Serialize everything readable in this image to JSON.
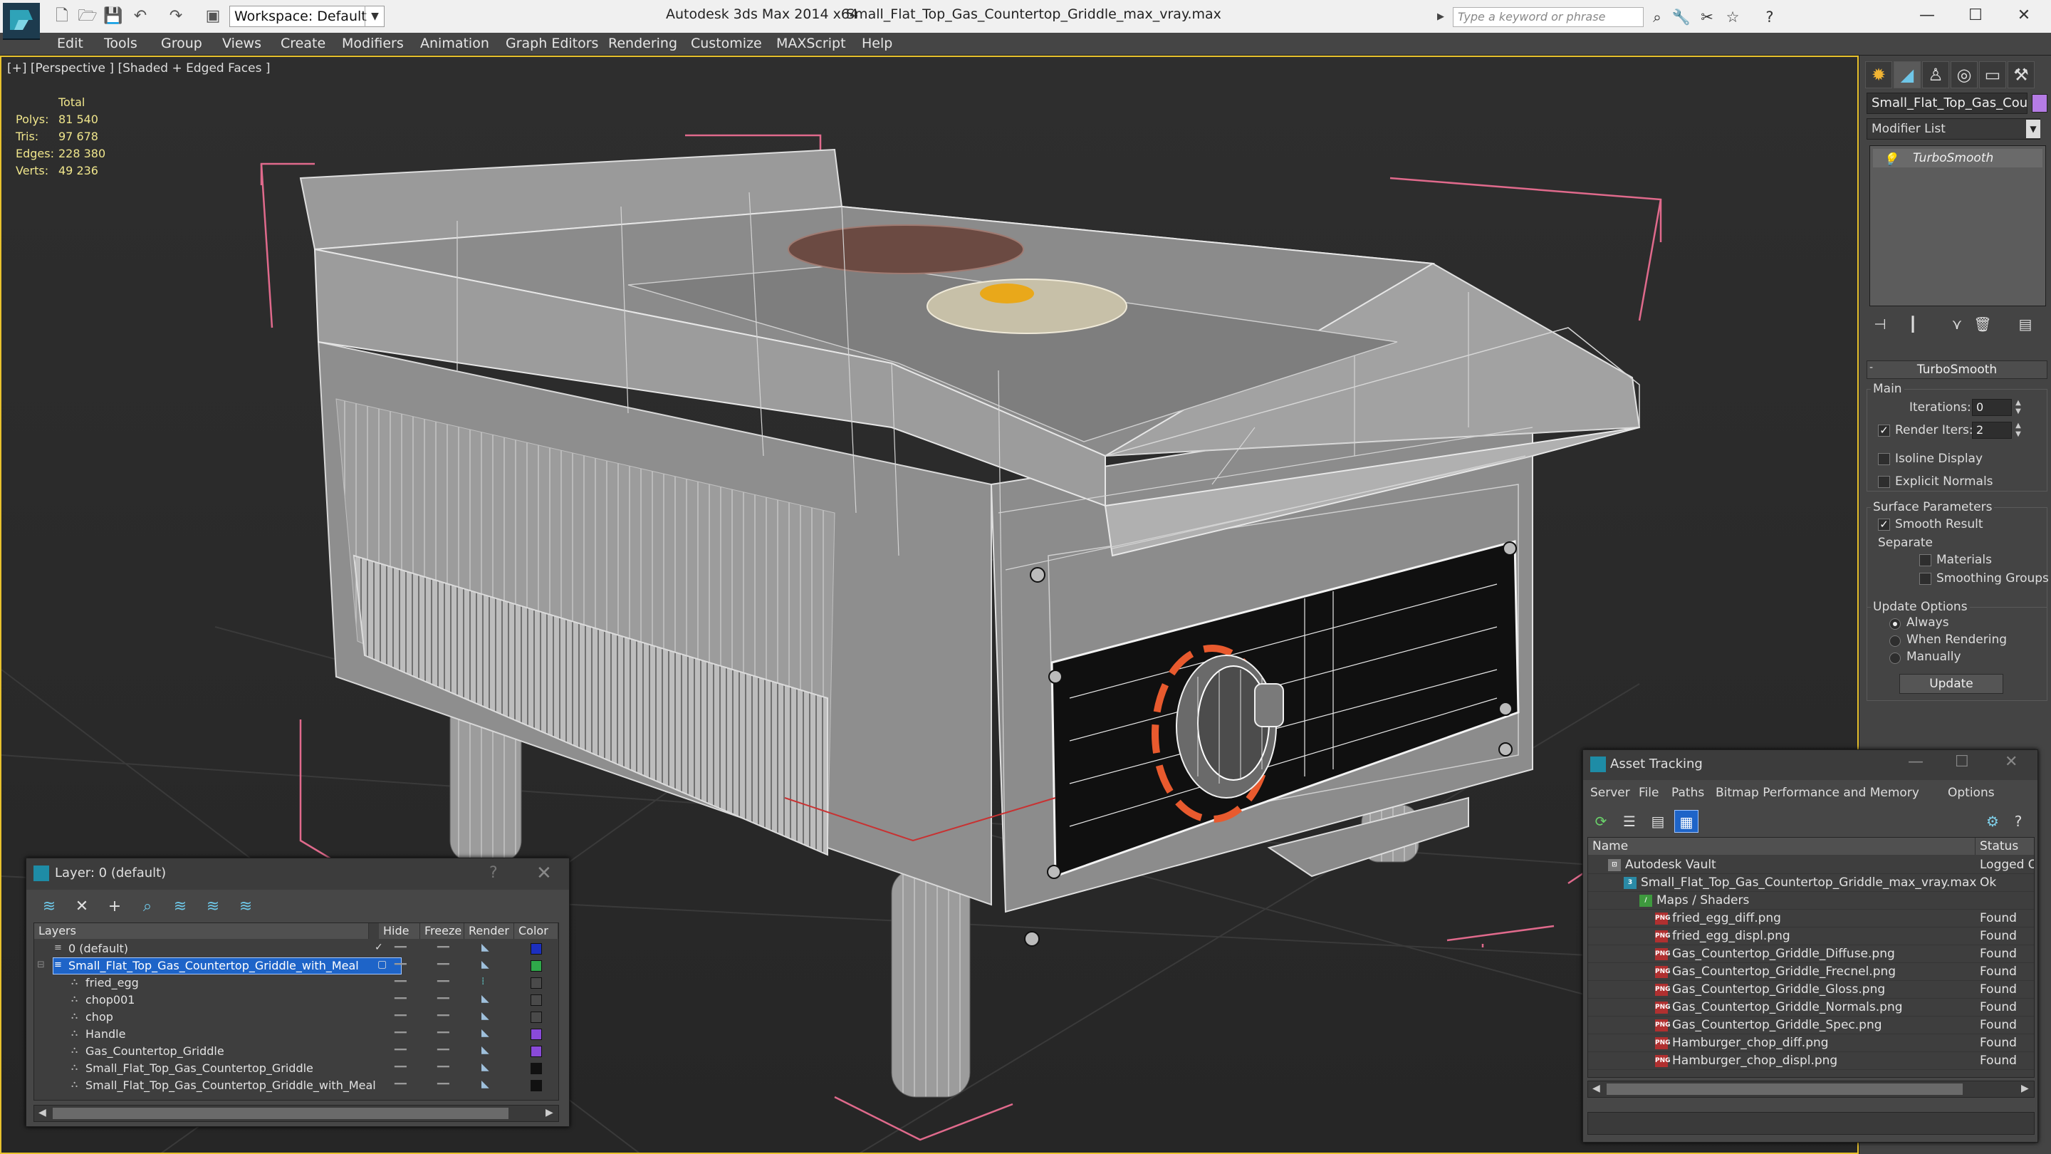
{
  "titlebar": {
    "workspace": "Workspace: Default",
    "app_title": "Autodesk 3ds Max  2014 x64",
    "file_title": "Small_Flat_Top_Gas_Countertop_Griddle_max_vray.max",
    "search_placeholder": "Type a keyword or phrase"
  },
  "menu": [
    "Edit",
    "Tools",
    "Group",
    "Views",
    "Create",
    "Modifiers",
    "Animation",
    "Graph Editors",
    "Rendering",
    "Customize",
    "MAXScript",
    "Help"
  ],
  "viewport": {
    "label": "[+] [Perspective ] [Shaded + Edged Faces ]",
    "stats": {
      "total": "Total",
      "rows": [
        {
          "label": "Polys:",
          "value": "81 540"
        },
        {
          "label": "Tris:",
          "value": "97 678"
        },
        {
          "label": "Edges:",
          "value": "228 380"
        },
        {
          "label": "Verts:",
          "value": "49 236"
        }
      ]
    }
  },
  "command_panel": {
    "object_name": "Small_Flat_Top_Gas_Cou",
    "object_color": "#b57ce5",
    "modifier_list": "Modifier List",
    "stack_item": "TurboSmooth",
    "rollout": "TurboSmooth",
    "main_group": "Main",
    "iterations_label": "Iterations:",
    "iterations_value": "0",
    "render_iters_label": "Render Iters:",
    "render_iters_value": "2",
    "isoline": "Isoline Display",
    "explicit_normals": "Explicit Normals",
    "surface_group": "Surface Parameters",
    "smooth_result": "Smooth Result",
    "separate": "Separate",
    "materials": "Materials",
    "smoothing_groups": "Smoothing Groups",
    "update_group": "Update Options",
    "always": "Always",
    "when_rendering": "When Rendering",
    "manually": "Manually",
    "update_button": "Update"
  },
  "layer_dialog": {
    "title": "Layer: 0 (default)",
    "help": "?",
    "columns": [
      "Layers",
      "Hide",
      "Freeze",
      "Render",
      "Color"
    ],
    "rows": [
      {
        "name": "0 (default)",
        "color": "#1c2fbf"
      },
      {
        "name": "Small_Flat_Top_Gas_Countertop_Griddle_with_Meal",
        "color": "#2fa84a"
      },
      {
        "name": "fried_egg",
        "color": "#4a4a4a"
      },
      {
        "name": "chop001",
        "color": "#4a4a4a"
      },
      {
        "name": "chop",
        "color": "#4a4a4a"
      },
      {
        "name": "Handle",
        "color": "#8a4ad8"
      },
      {
        "name": "Gas_Countertop_Griddle",
        "color": "#8a4ad8"
      },
      {
        "name": "Small_Flat_Top_Gas_Countertop_Griddle",
        "color": "#111111"
      },
      {
        "name": "Small_Flat_Top_Gas_Countertop_Griddle_with_Meal",
        "color": "#111111"
      }
    ]
  },
  "asset_dialog": {
    "title": "Asset Tracking",
    "menu": [
      "Server",
      "File",
      "Paths",
      "Bitmap Performance and Memory",
      "Options"
    ],
    "columns": [
      "Name",
      "Status"
    ],
    "rows": [
      {
        "name": "Autodesk Vault",
        "status": "Logged Out"
      },
      {
        "name": "Small_Flat_Top_Gas_Countertop_Griddle_max_vray.max",
        "status": "Ok"
      },
      {
        "name": "Maps / Shaders",
        "status": ""
      },
      {
        "name": "fried_egg_diff.png",
        "status": "Found"
      },
      {
        "name": "fried_egg_displ.png",
        "status": "Found"
      },
      {
        "name": "Gas_Countertop_Griddle_Diffuse.png",
        "status": "Found"
      },
      {
        "name": "Gas_Countertop_Griddle_Frecnel.png",
        "status": "Found"
      },
      {
        "name": "Gas_Countertop_Griddle_Gloss.png",
        "status": "Found"
      },
      {
        "name": "Gas_Countertop_Griddle_Normals.png",
        "status": "Found"
      },
      {
        "name": "Gas_Countertop_Griddle_Spec.png",
        "status": "Found"
      },
      {
        "name": "Hamburger_chop_diff.png",
        "status": "Found"
      },
      {
        "name": "Hamburger_chop_displ.png",
        "status": "Found"
      }
    ]
  },
  "colors": {
    "viewport_border": "#e8c22e",
    "stats_text": "#f0e68c",
    "selection": "#1e64c8"
  }
}
